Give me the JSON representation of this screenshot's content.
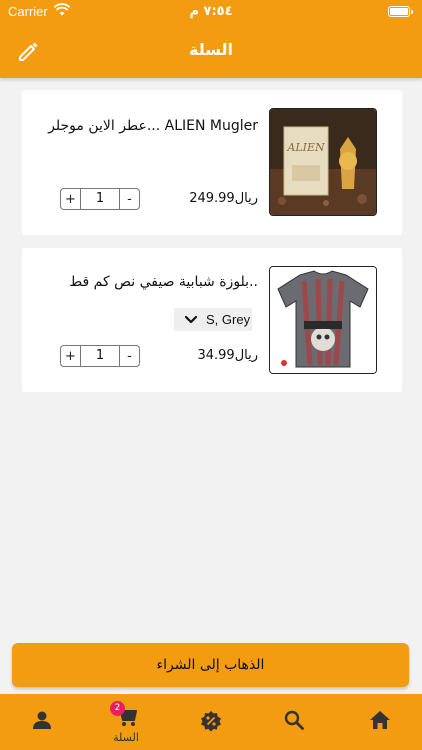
{
  "status_bar": {
    "carrier": "Carrier",
    "time": "٧:٥٤ م"
  },
  "header": {
    "title": "السلة",
    "edit_icon": "pencil-icon"
  },
  "cart_items": [
    {
      "name": "عطر الاين موجلر... ALIEN Mugler",
      "price": "249.99ريال",
      "quantity": "1",
      "plus_label": "+",
      "minus_label": "-"
    },
    {
      "name": "بلوزة شبابية صيفي نص كم قط..",
      "variant": "S, Grey",
      "price": "34.99ريال",
      "quantity": "1",
      "plus_label": "+",
      "minus_label": "-"
    }
  ],
  "checkout": {
    "label": "الذهاب إلى الشراء"
  },
  "tabbar": {
    "cart_label": "السلة",
    "cart_badge": "2",
    "icons": [
      "person-icon",
      "cart-icon",
      "discount-icon",
      "search-icon",
      "home-icon"
    ]
  },
  "colors": {
    "accent": "#f39c12",
    "badge": "#e91e63",
    "background": "#f2f2f2"
  }
}
